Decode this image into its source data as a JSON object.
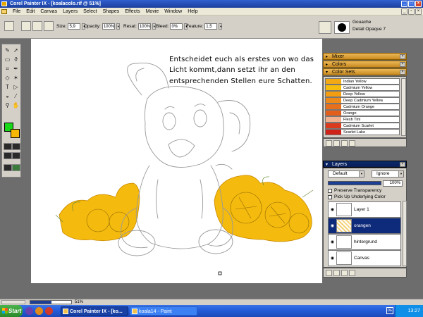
{
  "window": {
    "title": "Corel Painter IX - [koalacolo.rif @ 51%]"
  },
  "menu": [
    "File",
    "Edit",
    "Canvas",
    "Layers",
    "Select",
    "Shapes",
    "Effects",
    "Movie",
    "Window",
    "Help"
  ],
  "propbar": {
    "size_label": "Size:",
    "size_value": "5,9",
    "opacity_label": "Opacity:",
    "opacity_value": "100%",
    "resat_label": "Resat:",
    "resat_value": "100%",
    "bleed_label": "Bleed:",
    "bleed_value": "0%",
    "feature_label": "Feature:",
    "feature_value": "1,5"
  },
  "brush": {
    "category": "Gouache",
    "variant": "Detail Opaque 7"
  },
  "canvas": {
    "note": "Entscheidet euch als erstes von wo das Licht kommt,dann setzt ihr an den entsprechenden Stellen eure Schatten.",
    "zoom": "51%",
    "zoom_fraction": 0.51
  },
  "panels": {
    "mixer": "Mixer",
    "colors": "Colors",
    "color_sets": "Color Sets",
    "layers": "Layers"
  },
  "color_sets": [
    {
      "name": "Indian Yellow",
      "color": "#f3a914"
    },
    {
      "name": "Cadmium Yellow",
      "color": "#f6bd0d"
    },
    {
      "name": "Deep Yellow",
      "color": "#f59d10"
    },
    {
      "name": "Deep Cadmium Yellow",
      "color": "#ef8a18"
    },
    {
      "name": "Cadmium Orange",
      "color": "#e8701c"
    },
    {
      "name": "Orange",
      "color": "#e35e1a"
    },
    {
      "name": "Flesh Tint",
      "color": "#f3b08e"
    },
    {
      "name": "Cadmium Scarlet",
      "color": "#dc3a1c"
    },
    {
      "name": "Scarlet Lake",
      "color": "#cf2319"
    }
  ],
  "layers_panel": {
    "composite": "Default",
    "mode": "Ignore",
    "opacity": "100%",
    "preserve": "Preserve Transparency",
    "pickup": "Pick Up Underlying Color",
    "items": [
      "Layer 1",
      "orangen",
      "hintergrund",
      "Canvas"
    ]
  },
  "taskbar": {
    "start": "Start",
    "tasks": [
      "Corel Painter IX - [ko...",
      "koala14 - Paint"
    ],
    "lang": "DE",
    "clock": "13:27"
  },
  "colors": {
    "primary": "#18d818",
    "secondary": "#f6b800",
    "fill": "#f5ba0e"
  }
}
